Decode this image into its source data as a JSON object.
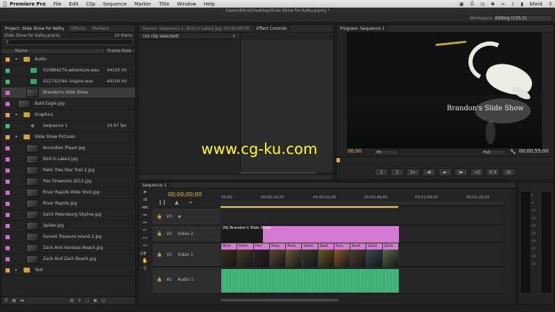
{
  "menubar": {
    "app": "Premiere Pro",
    "items": [
      "File",
      "Edit",
      "Clip",
      "Sequence",
      "Marker",
      "Title",
      "Window",
      "Help"
    ],
    "user": "bford"
  },
  "window": {
    "title": "/Users/bford/Desktop/Slide Show for Kelby.prproj *"
  },
  "workspace": {
    "label": "Workspace:",
    "value": "Editing (CS5.5)"
  },
  "project": {
    "tabs": [
      "Project: Slide Show for Kelby",
      "Effects",
      "Markers"
    ],
    "file": "Slide Show for Kelby.prproj",
    "count": "20 Items",
    "col_name": "Name",
    "col_rate": "Frame Rate",
    "rows": [
      {
        "name": "Audio",
        "kind": "folder",
        "label_color": "#e4a43c",
        "indent": 0
      },
      {
        "name": "010894270-adventure.wav",
        "kind": "audio",
        "rate": "44100 Hz",
        "label_color": "#3fbf6a",
        "indent": 1
      },
      {
        "name": "012732194--inspire.wav",
        "kind": "audio",
        "rate": "44100 Hz",
        "label_color": "#3fbf6a",
        "indent": 1
      },
      {
        "name": "Brandon's Slide Show",
        "kind": "thumb",
        "label_color": "#d36ad0",
        "indent": 1,
        "selected": true
      },
      {
        "name": "Bald Eagle.jpg",
        "kind": "thumb",
        "label_color": "#d36ad0",
        "indent": 0
      },
      {
        "name": "Graphics",
        "kind": "folder",
        "label_color": "#e4a43c",
        "indent": 0
      },
      {
        "name": "Sequence 1",
        "kind": "sequence",
        "rate": "29.97 fps",
        "label_color": "#3fbf6a",
        "indent": 1
      },
      {
        "name": "Slide Show Pictures",
        "kind": "folder",
        "label_color": "#e4a43c",
        "indent": 0
      },
      {
        "name": "Accordian Player.jpg",
        "kind": "thumb",
        "label_color": "#d36ad0",
        "indent": 1
      },
      {
        "name": "Bird in Lake3.jpg",
        "kind": "thumb",
        "label_color": "#d36ad0",
        "indent": 1
      },
      {
        "name": "Palm Tree Star Trail 2.jpg",
        "kind": "thumb",
        "label_color": "#d36ad0",
        "indent": 1
      },
      {
        "name": "Pier Fireworks 2013.jpg",
        "kind": "thumb",
        "label_color": "#d36ad0",
        "indent": 1
      },
      {
        "name": "River Rapids Wide Shot.jpg",
        "kind": "thumb",
        "label_color": "#d36ad0",
        "indent": 1
      },
      {
        "name": "River Rapids.jpg",
        "kind": "thumb",
        "label_color": "#d36ad0",
        "indent": 1
      },
      {
        "name": "Saint Petersburg Skyline.jpg",
        "kind": "thumb",
        "label_color": "#d36ad0",
        "indent": 1
      },
      {
        "name": "Spider.jpg",
        "kind": "thumb",
        "label_color": "#d36ad0",
        "indent": 1
      },
      {
        "name": "Sunset Treasure Island 2.jpg",
        "kind": "thumb",
        "label_color": "#d36ad0",
        "indent": 1
      },
      {
        "name": "Zack And Vanessa Beach.jpg",
        "kind": "thumb",
        "label_color": "#d36ad0",
        "indent": 1
      },
      {
        "name": "Zack And Zach Beach.jpg",
        "kind": "thumb",
        "label_color": "#d36ad0",
        "indent": 1
      },
      {
        "name": "Text",
        "kind": "folder",
        "label_color": "#e4a43c",
        "indent": 0,
        "collapsed": true
      }
    ]
  },
  "source": {
    "tabs": [
      "Source: Sequence 1: Bird in Lake3.jpg: 00;00;00;00",
      "Effect Controls"
    ],
    "no_clip": "(no clip selected)"
  },
  "program": {
    "tab": "Program: Sequence 1",
    "overlay_title": "Brandon's Slide Show",
    "timecode_left": "00;00",
    "fit": "Fit",
    "quality": "Full",
    "timecode_right": "00;00;55;00",
    "buttons": [
      "{",
      "}",
      "{←",
      "◄|",
      "►",
      "|►",
      "→}",
      "⊏⊐",
      "⊡"
    ]
  },
  "timeline": {
    "tab": "Sequence 1",
    "timecode": "00;00;00;00",
    "ruler_labels": [
      "00;00",
      "00;00;16;00",
      "00;00;32;00",
      "00;00;48;00",
      "00;01;04;02",
      "00;01;20;02"
    ],
    "tracks": [
      {
        "id": "V3",
        "name": ""
      },
      {
        "id": "V2",
        "name": "Video 2"
      },
      {
        "id": "V1",
        "name": "Video 1"
      },
      {
        "id": "A1",
        "name": "Audio 1"
      }
    ],
    "v2_clip": "[N] Brandon's Slide Show",
    "v1_clips": [
      "Bird",
      "Palm",
      "Pier",
      "Rive",
      "Rive",
      "Saint",
      "Spid",
      "Sun:",
      "Bald",
      "Zack",
      "Zack"
    ],
    "source_patch": "V1"
  },
  "meters": {
    "scale": [
      "0",
      "-6",
      "-12",
      "-18",
      "-24",
      "-30",
      "-36",
      "-42",
      "-48",
      "-54"
    ]
  },
  "watermark": "www.cg-ku.com",
  "colors": {
    "timecode": "#e8c54a",
    "clip_pink": "#d47ad1",
    "audio_green": "#2a9c62"
  }
}
